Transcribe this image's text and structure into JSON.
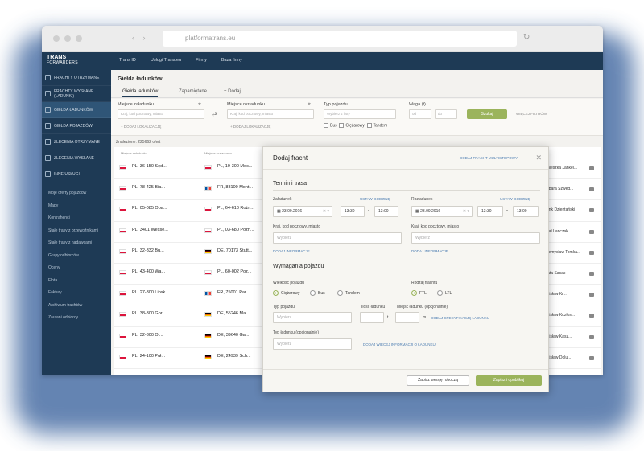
{
  "browser": {
    "url": "platformatrans.eu"
  },
  "app": {
    "logo_main": "TRANS",
    "logo_sub": "FORWARDERS",
    "top_menu": [
      "Trans ID",
      "Usługi Trans.eu",
      "Firmy",
      "Baza firmy"
    ]
  },
  "sidebar": {
    "items": [
      {
        "label": "Frachty otrzymane",
        "active": false
      },
      {
        "label": "Frachty wysłane (ładunki)",
        "active": false
      },
      {
        "label": "Giełda ładunków",
        "active": true
      },
      {
        "label": "Giełda pojazdów",
        "active": false
      },
      {
        "label": "Zlecenia otrzymane",
        "active": false
      },
      {
        "label": "Zlecenia wysłane",
        "active": false
      },
      {
        "label": "Inne usługi",
        "active": false
      }
    ],
    "sub_items": [
      "Moje oferty pojazdów",
      "Mapy",
      "Kontrahenci",
      "Stałe trasy z przewoźnikami",
      "Stałe trasy z nadawcami",
      "Grupy odbiorców",
      "Oceny",
      "Flota",
      "Faktury",
      "Archiwum frachtów",
      "Zaufani odbiorcy"
    ]
  },
  "main": {
    "title": "Giełda ładunków",
    "tabs": [
      "Giełda ładunków",
      "Zapamiętane",
      "+ Dodaj"
    ],
    "filters": {
      "pickup_label": "Miejsce załadunku",
      "pickup_placeholder": "Kraj, kod pocztowy, miasto",
      "delivery_label": "Miejsce rozładunku",
      "delivery_placeholder": "Kraj, kod pocztowy, miasto",
      "vehicle_label": "Typ pojazdu",
      "vehicle_placeholder": "Wybierz z listy",
      "weight_label": "Waga (t)",
      "weight_from": "od",
      "weight_to": "do",
      "add_location": "+ Dodaj lokalizację",
      "add_location2": "+ Dodaj lokalizację",
      "search_button": "Szukaj",
      "more_filters": "Więcej filtrów",
      "checks": [
        "Bus",
        "Ciężarowy",
        "Tandem"
      ]
    },
    "count": "Znalezione: 225662 ofert",
    "table_headers": [
      "Miejsce załadunku",
      "Miejsce rozładunku"
    ],
    "rows": [
      {
        "from": "PL, 36-150 Sęd...",
        "to": "PL, 19-300 Moc...",
        "contact": "Agnieszka Jankel..."
      },
      {
        "from": "PL, 78-425 Bia...",
        "to": "FR, 88100 Mont...",
        "contact": "Barbara Szwed..."
      },
      {
        "from": "PL, 05-085 Opa...",
        "to": "PL, 64-610 Rożn...",
        "contact": "Bronk Dzierżański"
      },
      {
        "from": "PL, 3401 Wesse...",
        "to": "PL, 03-680 Pozn...",
        "contact": "Rafał Lanczak"
      },
      {
        "from": "PL, 32-332 Bu...",
        "to": "DE, 70173 Stutt...",
        "contact": "Przemysław Tomka..."
      },
      {
        "from": "PL, 43-400 Wa...",
        "to": "PL, 60-002 Poz...",
        "contact": "Beata Sasac"
      },
      {
        "from": "PL, 27-300 Lipsk...",
        "to": "FR, 75001 Par...",
        "contact": "Zdzisław Kr..."
      },
      {
        "from": "PL, 38-300 Gor...",
        "to": "DE, 55246 Ma...",
        "contact": "Zdzisław Kozłos..."
      },
      {
        "from": "PL, 32-300 Ol...",
        "to": "DE, 39640 Gar...",
        "contact": "Zdzisław Kasz..."
      },
      {
        "from": "PL, 24-100 Puł...",
        "to": "DE, 24939 Sch...",
        "contact": "Zdzisław Dolu..."
      }
    ]
  },
  "modal": {
    "title": "Dodaj fracht",
    "multistop_link": "Dodaj fracht multistopowy",
    "close_icon": "close-icon",
    "section_route": "Termin i trasa",
    "loading_label": "Załadunek",
    "unloading_label": "Rozładunek",
    "set_range": "Ustaw godzinę",
    "set_range2": "Ustaw godzinę",
    "loading_date": "23.09.2016",
    "unloading_date": "23.09.2016",
    "loading_time_from": "13:30",
    "loading_time_to": "13:00",
    "unloading_time_from": "13:30",
    "unloading_time_to": "13:00",
    "place_label": "Kraj, kod pocztowy, miasto",
    "place_label2": "Kraj, kod pocztowy, miasto",
    "place_placeholder": "Wybierz",
    "place_placeholder2": "Wybierz",
    "add_info": "Dodaj informacje",
    "add_info2": "Dodaj informacje",
    "section_vehicle": "Wymagania pojazdu",
    "vehicle_size_label": "Wielkość pojazdu",
    "vehicle_sizes": [
      "Ciężarowy",
      "Bus",
      "Tandem"
    ],
    "freight_type_label": "Rodzaj frachtu",
    "freight_types": [
      "FTL",
      "LTL"
    ],
    "body_type_label": "Typ pojazdu",
    "body_placeholder": "Wybierz",
    "quantity_label": "Ilość ładunku",
    "capacity_label": "Miejsc ładunku (opcjonalnie)",
    "unit_t": "t",
    "unit_m": "m",
    "add_spec": "Dodaj specyfikację ładunku",
    "trailer_label": "Typ ładunku (opcjonalnie)",
    "trailer_placeholder": "Wybierz",
    "add_more": "Dodaj więcej informacji o ładunku",
    "btn_save": "Zapisz wersję roboczą",
    "btn_publish": "Zapisz i opublikuj"
  },
  "colors": {
    "navy": "#1e3a55",
    "accent_green": "#9bb45c",
    "link_blue": "#4a7bb0"
  }
}
